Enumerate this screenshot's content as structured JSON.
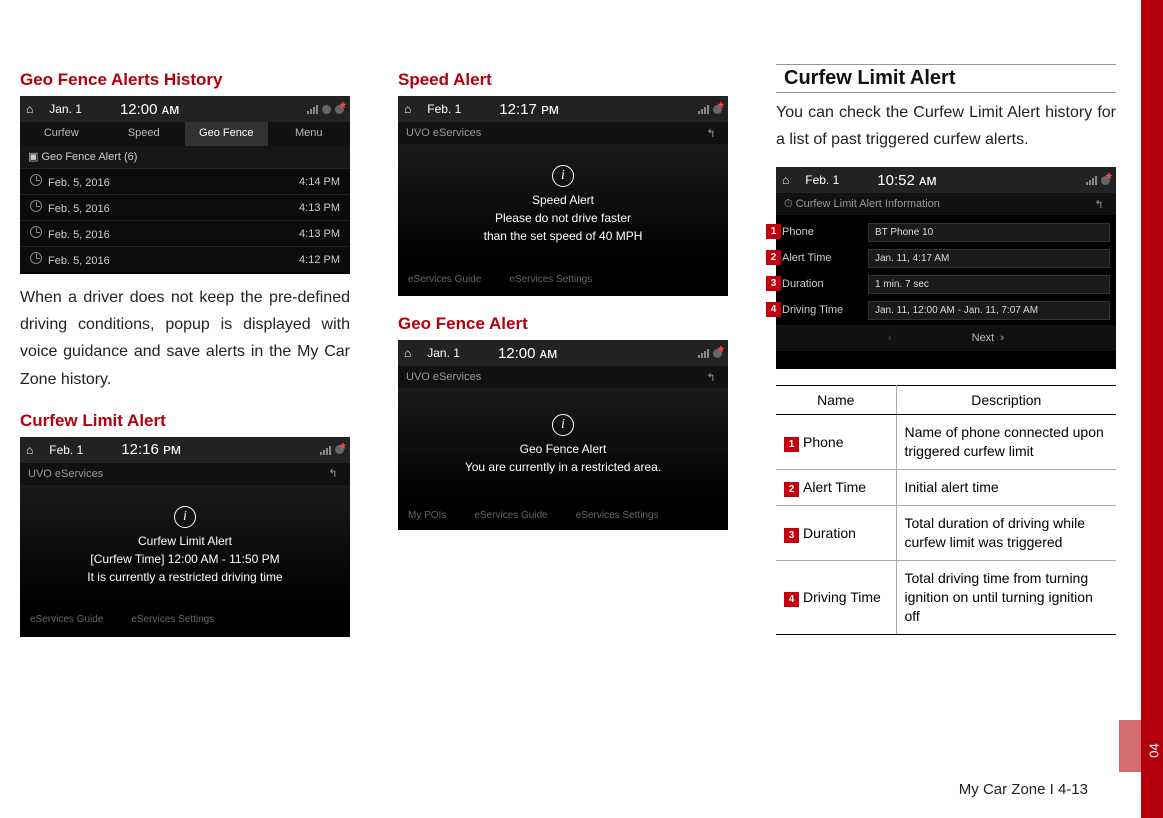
{
  "sidebar": {
    "chapter": "04"
  },
  "footer": "My Car Zone I 4-13",
  "col1": {
    "h1": "Geo Fence Alerts History",
    "shot1": {
      "date": "Jan. 1",
      "time": "12:00 ᴀᴍ",
      "tabs": [
        "Curfew",
        "Speed",
        "Geo Fence",
        "Menu"
      ],
      "active_tab": 2,
      "list_title": "Geo Fence Alert (6)",
      "rows": [
        {
          "date": "Feb. 5, 2016",
          "time": "4:14 PM"
        },
        {
          "date": "Feb. 5, 2016",
          "time": "4:13 PM"
        },
        {
          "date": "Feb. 5, 2016",
          "time": "4:13 PM"
        },
        {
          "date": "Feb. 5, 2016",
          "time": "4:12 PM"
        }
      ]
    },
    "para": "When a driver does not keep the pre-defined driving conditions, popup is displayed with voice guidance and save alerts in the My Car Zone history.",
    "h2": "Curfew Limit Alert",
    "shot2": {
      "date": "Feb. 1",
      "time": "12:16 ᴘᴍ",
      "svc": "UVO eServices",
      "title": "Curfew Limit Alert",
      "line1": "[Curfew Time] 12:00 AM - 11:50 PM",
      "line2": "It is currently a restricted driving time",
      "bottom": [
        "eServices Guide",
        "eServices Settings"
      ]
    }
  },
  "col2": {
    "h1": "Speed Alert",
    "shot1": {
      "date": "Feb. 1",
      "time": "12:17 ᴘᴍ",
      "svc": "UVO eServices",
      "title": "Speed Alert",
      "line1": "Please do not drive faster",
      "line2": "than the set speed of 40 MPH",
      "bottom": [
        "eServices Guide",
        "eServices Settings"
      ]
    },
    "h2": "Geo Fence Alert",
    "shot2": {
      "date": "Jan. 1",
      "time": "12:00 ᴀᴍ",
      "svc": "UVO eServices",
      "title": "Geo Fence Alert",
      "line1": "You are currently in a restricted area.",
      "bottom": [
        "My POIs",
        "eServices Guide",
        "eServices Settings"
      ]
    }
  },
  "col3": {
    "h1": "Curfew Limit Alert",
    "para": "You can check the Curfew Limit Alert history for a list of past triggered curfew alerts.",
    "shot": {
      "date": "Feb. 1",
      "time": "10:52 ᴀᴍ",
      "title": "Curfew Limit Alert Information",
      "rows": [
        {
          "n": "1",
          "label": "Phone",
          "value": "BT Phone 10"
        },
        {
          "n": "2",
          "label": "Alert Time",
          "value": "Jan. 11, 4:17 AM"
        },
        {
          "n": "3",
          "label": "Duration",
          "value": "1 min. 7 sec"
        },
        {
          "n": "4",
          "label": "Driving Time",
          "value": "Jan. 11, 12:00 AM - Jan. 11, 7:07 AM"
        }
      ],
      "next": "Next"
    },
    "table": {
      "head": [
        "Name",
        "Description"
      ],
      "rows": [
        {
          "n": "1",
          "name": "Phone",
          "desc": "Name of phone connected upon triggered curfew limit"
        },
        {
          "n": "2",
          "name": "Alert Time",
          "desc": "Initial alert time"
        },
        {
          "n": "3",
          "name": "Duration",
          "desc": "Total duration of driving while curfew limit was triggered"
        },
        {
          "n": "4",
          "name": "Driving Time",
          "desc": "Total driving time from turning ignition on until turning ignition off"
        }
      ]
    }
  }
}
